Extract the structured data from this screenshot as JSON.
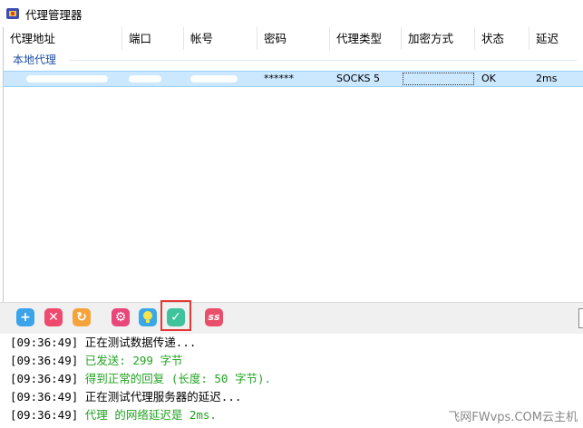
{
  "window": {
    "title": "代理管理器"
  },
  "columns": [
    "代理地址",
    "端口",
    "帐号",
    "密码",
    "代理类型",
    "加密方式",
    "状态",
    "延迟"
  ],
  "group": {
    "label": "本地代理"
  },
  "rows": [
    {
      "address": "",
      "port": "",
      "account": "",
      "password": "******",
      "type": "SOCKS 5",
      "encryption": "",
      "status": "OK",
      "latency": "2ms"
    }
  ],
  "toolbar": {
    "buttons": [
      {
        "name": "add-icon",
        "glyph": "+",
        "color": "#3ba3ea"
      },
      {
        "name": "delete-icon",
        "glyph": "✕",
        "color": "#ef4a6d"
      },
      {
        "name": "refresh-icon",
        "glyph": "↻",
        "color": "#f4a43b"
      },
      {
        "name": "settings-icon",
        "glyph": "⚙",
        "color": "#e9467a"
      },
      {
        "name": "tip-icon",
        "glyph": "💡",
        "color": "#3aa8e8"
      },
      {
        "name": "check-icon",
        "glyph": "✓",
        "color": "#3fc39b"
      },
      {
        "name": "ss-icon",
        "glyph": "ss",
        "color": "#e94f6a"
      }
    ]
  },
  "log": [
    {
      "time": "[09:36:49]",
      "text": "正在测试数据传递...",
      "color": "#000000"
    },
    {
      "time": "[09:36:49]",
      "text": "已发送: 299 字节",
      "color": "#22a322"
    },
    {
      "time": "[09:36:49]",
      "text": "得到正常的回复 (长度: 50 字节).",
      "color": "#22a322"
    },
    {
      "time": "[09:36:49]",
      "text": "正在测试代理服务器的延迟...",
      "color": "#000000"
    },
    {
      "time": "[09:36:49]",
      "text": "代理 的网络延迟是 2ms.",
      "color": "#22a322"
    }
  ],
  "watermark": "飞网FWvps.COM云主机"
}
